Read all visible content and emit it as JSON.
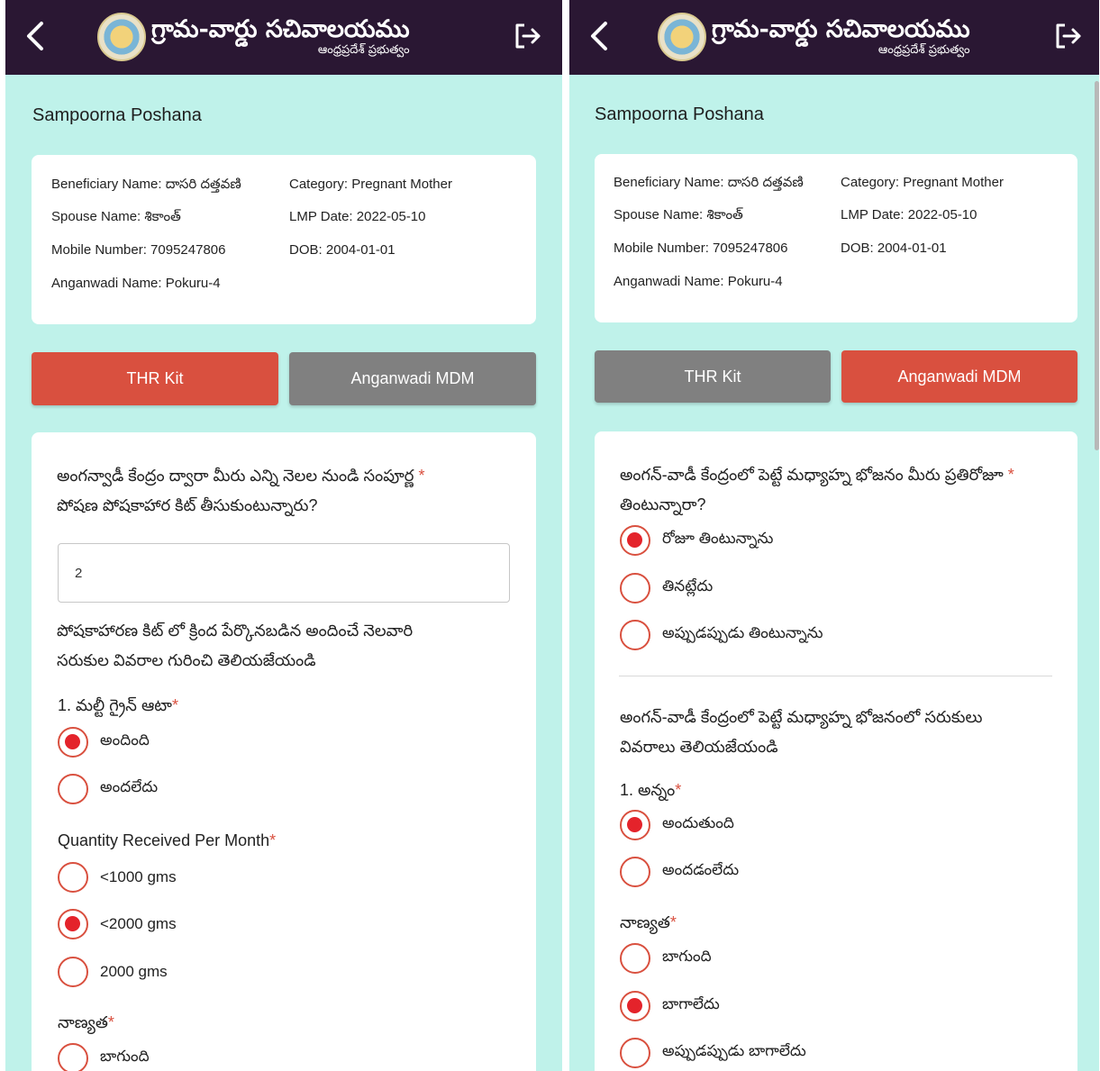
{
  "header": {
    "title": "గ్రామ-వార్డు సచివాలయము",
    "subtitle": "ఆంధ్రప్రదేశ్ ప్రభుత్వం",
    "back_icon": "chevron-left-icon",
    "logout_icon": "logout-icon"
  },
  "colors": {
    "topbar": "#2a1733",
    "background": "#bff2ea",
    "active_tab": "#d9503f",
    "inactive_tab": "#808080",
    "radio_accent": "#e4232b"
  },
  "page_title": "Sampoorna Poshana",
  "beneficiary": {
    "name_label": "Beneficiary Name:",
    "name": "దాసరి దత్తవణి",
    "spouse_label": "Spouse Name:",
    "spouse": "శికాంత్",
    "mobile_label": "Mobile Number:",
    "mobile": "7095247806",
    "anganwadi_label": "Anganwadi Name:",
    "anganwadi": "Pokuru-4",
    "category_label": "Category:",
    "category": "Pregnant Mother",
    "lmp_label": "LMP Date:",
    "lmp": "2022-05-10",
    "dob_label": "DOB:",
    "dob": "2004-01-01"
  },
  "tabs": {
    "thr": "THR Kit",
    "mdm": "Anganwadi MDM"
  },
  "left": {
    "active_tab": "THR Kit",
    "q1_line1": "అంగన్వాడీ కేంద్రం ద్వారా మీరు ఎన్ని నెలల నుండి సంపూర్ణ",
    "q1_line2": "పోషణ పోషకాహార కిట్ తీసుకుంటున్నారు?",
    "q1_value": "2",
    "info_line1": "పోషకాహారణ కిట్ లో క్రింద పేర్కొనబడిన అందించే నెలవారి",
    "info_line2": "సరుకుల వివరాల గురించి తెలియజేయండి",
    "item1": "1. మల్టీ గ్రైన్ ఆటా",
    "item1_options": [
      "అందింది",
      "అందలేదు"
    ],
    "item1_selected": "అందింది",
    "quantity_label": "Quantity Received Per Month",
    "quantity_options": [
      "<1000 gms",
      "<2000 gms",
      "2000 gms"
    ],
    "quantity_selected": "<2000 gms",
    "quality_label": "నాణ్యత",
    "quality_first_option": "బాగుంది"
  },
  "right": {
    "active_tab": "Anganwadi MDM",
    "q1_line1": "అంగన్-వాడీ కేంద్రంలో పెట్టే మధ్యాహ్న భోజనం మీరు ప్రతిరోజూ",
    "q1_line2": "తింటున్నారా?",
    "q1_options": [
      "రోజూ తింటున్నాను",
      "తినట్లేదు",
      "అప్పుడప్పుడు తింటున్నాను"
    ],
    "q1_selected": "రోజూ తింటున్నాను",
    "info_line1": "అంగన్-వాడీ కేంద్రంలో పెట్టే మధ్యాహ్న భోజనంలో సరుకులు",
    "info_line2": "వివరాలు తెలియజేయండి",
    "item1": "1. అన్నం",
    "item1_options": [
      "అందుతుంది",
      "అందడంలేదు"
    ],
    "item1_selected": "అందుతుంది",
    "quality_label": "నాణ్యత",
    "quality_options": [
      "బాగుంది",
      "బాగాలేదు",
      "అప్పుడప్పుడు బాగాలేదు"
    ],
    "quality_selected": "బాగాలేదు"
  }
}
